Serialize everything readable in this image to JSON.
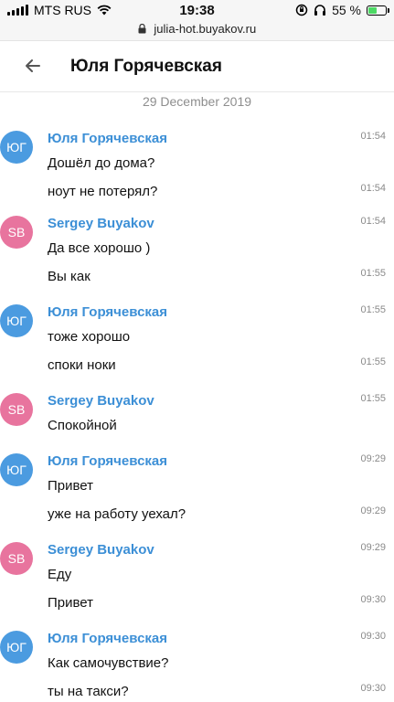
{
  "status_bar": {
    "carrier": "MTS RUS",
    "time": "19:38",
    "battery_percent": "55 %",
    "battery_level": 0.55,
    "battery_color": "#4cd964"
  },
  "url_bar": {
    "url": "julia-hot.buyakov.ru",
    "lock_icon": "lock-icon"
  },
  "header": {
    "title": "Юля Горячевская",
    "back_icon": "arrow-left-icon"
  },
  "date_separator": "29 December 2019",
  "colors": {
    "author": "#3c8fd6",
    "avatar_yg": "#4b9be0",
    "avatar_sb": "#e8749e"
  },
  "messages": [
    {
      "author": "Юля Горячевская",
      "avatar": "ЮГ",
      "lines": [
        {
          "text": "Дошёл до дома?",
          "time": "01:54"
        },
        {
          "text": "ноут не потерял?",
          "time": "01:54"
        }
      ]
    },
    {
      "author": "Sergey Buyakov",
      "avatar": "SB",
      "lines": [
        {
          "text": "Да все хорошо )",
          "time": "01:54"
        },
        {
          "text": "Вы как",
          "time": "01:55"
        }
      ]
    },
    {
      "author": "Юля Горячевская",
      "avatar": "ЮГ",
      "lines": [
        {
          "text": "тоже хорошо",
          "time": "01:55"
        },
        {
          "text": "споки ноки",
          "time": "01:55"
        }
      ]
    },
    {
      "author": "Sergey Buyakov",
      "avatar": "SB",
      "lines": [
        {
          "text": "Спокойной",
          "time": "01:55"
        }
      ]
    },
    {
      "author": "Юля Горячевская",
      "avatar": "ЮГ",
      "lines": [
        {
          "text": "Привет",
          "time": "09:29"
        },
        {
          "text": "уже на работу уехал?",
          "time": "09:29"
        }
      ]
    },
    {
      "author": "Sergey Buyakov",
      "avatar": "SB",
      "lines": [
        {
          "text": "Еду",
          "time": "09:29"
        },
        {
          "text": "Привет",
          "time": "09:30"
        }
      ]
    },
    {
      "author": "Юля Горячевская",
      "avatar": "ЮГ",
      "lines": [
        {
          "text": "Как самочувствие?",
          "time": "09:30"
        },
        {
          "text": "ты на такси?",
          "time": "09:30"
        }
      ]
    }
  ]
}
